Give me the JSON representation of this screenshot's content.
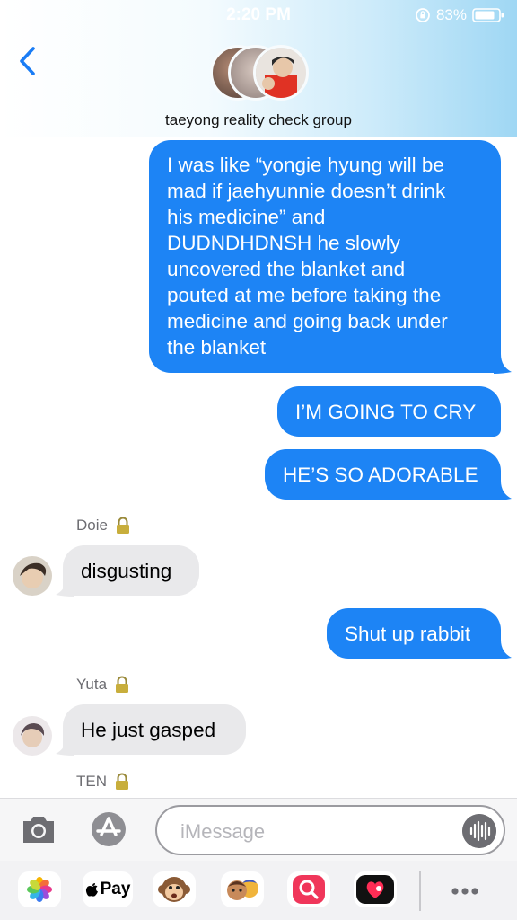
{
  "status_bar": {
    "time": "2:20 PM",
    "battery_percent": "83%"
  },
  "header": {
    "group_name": "taeyong reality check group"
  },
  "messages": [
    {
      "type": "sent",
      "text": "I was like “yongie hyung will be\nmad if jaehyunnie doesn’t drink\nhis medicine” and\nDUDNDHDNSH he slowly\nuncovered the blanket and\npouted at me before taking the\nmedicine and going back under\nthe blanket"
    },
    {
      "type": "sent",
      "text": "I’M GOING TO CRY"
    },
    {
      "type": "sent",
      "text": "HE’S SO ADORABLE"
    },
    {
      "type": "sender",
      "name": "Doie"
    },
    {
      "type": "received",
      "text": "disgusting"
    },
    {
      "type": "sent",
      "text": "Shut up rabbit"
    },
    {
      "type": "sender",
      "name": "Yuta"
    },
    {
      "type": "received",
      "text": "He just gasped"
    },
    {
      "type": "sender",
      "name": "TEN"
    }
  ],
  "input": {
    "placeholder": "iMessage"
  },
  "drawer": {
    "apple_pay_label": "Pay"
  },
  "icons": {
    "back": "chevron-left-icon",
    "camera": "camera-icon",
    "app_store": "app-store-icon",
    "audio": "waveform-icon",
    "lock": "lock-icon",
    "more": "ellipsis-icon"
  },
  "colors": {
    "sent_bubble": "#1d84f5",
    "received_bubble": "#e9e9eb",
    "accent": "#1a7cf5",
    "header_gradient_end": "#9fd7f4"
  }
}
